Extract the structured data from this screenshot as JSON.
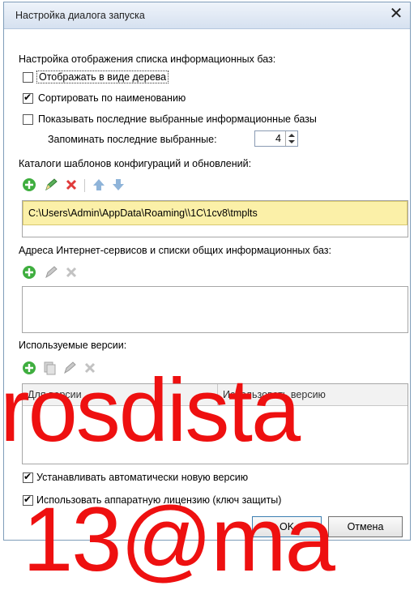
{
  "title": "Настройка диалога запуска",
  "section_display": "Настройка отображения списка информационных баз:",
  "options": {
    "tree_view": {
      "label": "Отображать в виде дерева",
      "checked": false
    },
    "sort_by_name": {
      "label": "Сортировать по наименованию",
      "checked": true
    },
    "show_recent": {
      "label": "Показывать последние выбранные информационные базы",
      "checked": false
    }
  },
  "remember_recent": {
    "label": "Запоминать последние выбранные:",
    "value": "4"
  },
  "templates": {
    "label": "Каталоги шаблонов конфигураций и обновлений:",
    "icons": [
      "add-icon",
      "edit-icon",
      "delete-icon",
      "move-up-icon",
      "move-down-icon"
    ],
    "items": [
      "C:\\Users\\Admin\\AppData\\Roaming\\\\1C\\1cv8\\tmplts"
    ]
  },
  "internet_services": {
    "label": "Адреса Интернет-сервисов и списки общих информационных баз:",
    "icons": [
      "add-icon",
      "edit-icon",
      "delete-icon"
    ]
  },
  "versions": {
    "label": "Используемые версии:",
    "icons": [
      "add-icon",
      "copy-icon",
      "edit-icon",
      "delete-icon"
    ],
    "columns": [
      "Для версии",
      "Использовать версию"
    ]
  },
  "auto_install": {
    "label": "Устанавливать автоматически новую версию",
    "checked": true
  },
  "hardware_license": {
    "label": "Использовать аппаратную лицензию (ключ защиты)",
    "checked": true
  },
  "buttons": {
    "ok": "OK",
    "cancel": "Отмена"
  },
  "watermark": {
    "line1": "rosdista",
    "line2": "13@ma"
  },
  "colors": {
    "watermark": "#ee1010",
    "selected_row": "#fbf0a8",
    "add_icon": "#3fae3f",
    "delete_icon": "#e03a3a"
  }
}
